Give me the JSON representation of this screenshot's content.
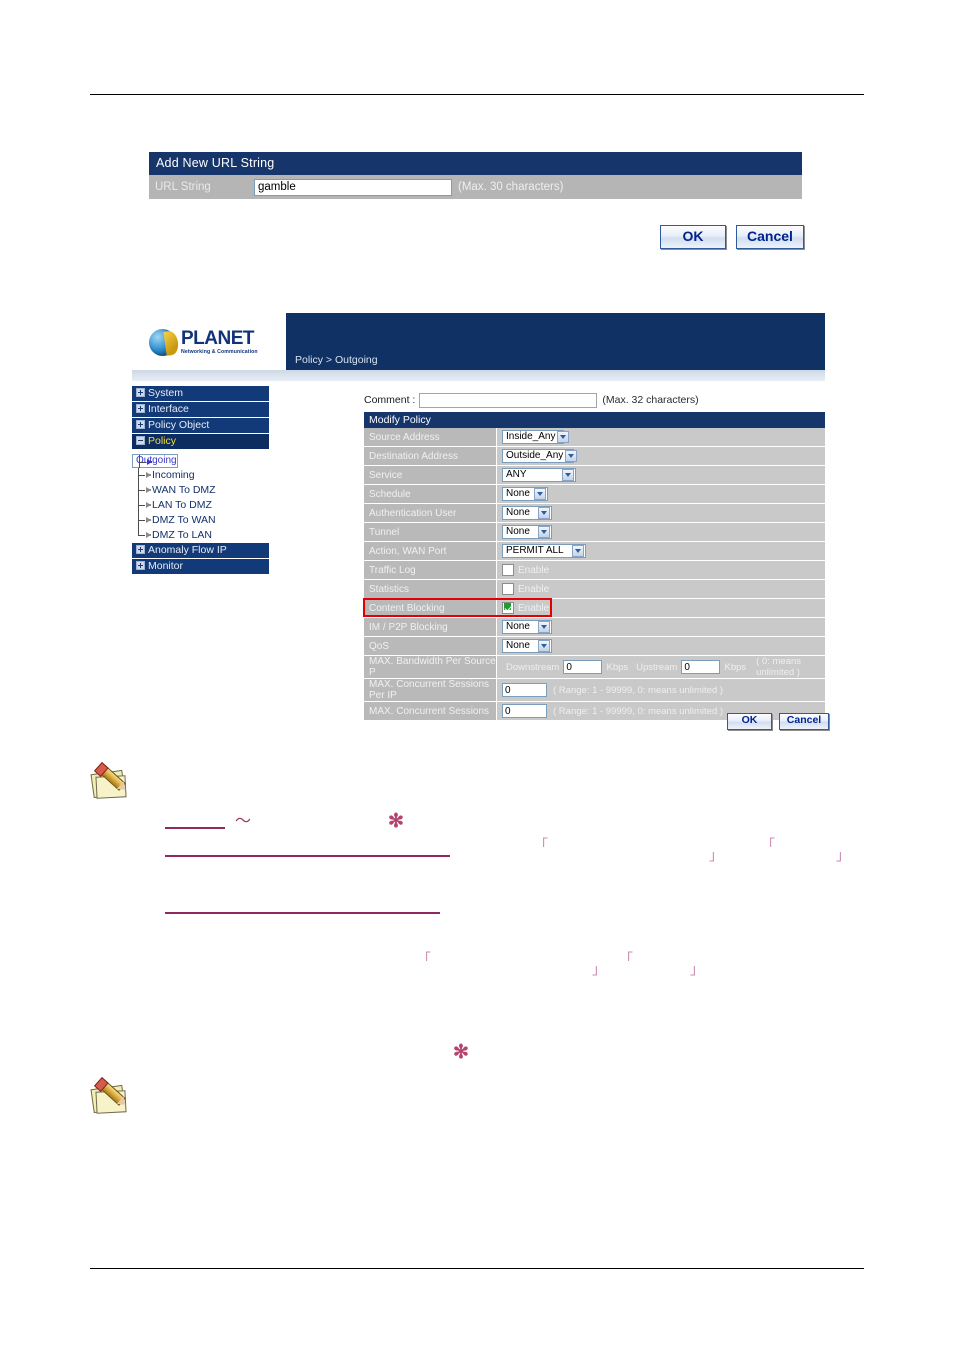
{
  "panel_url": {
    "title": "Add New URL String",
    "field_label": "URL String",
    "field_value": "gamble",
    "field_hint": "(Max. 30 characters)",
    "ok_label": "OK",
    "cancel_label": "Cancel"
  },
  "device": {
    "logo_word": "PLANET",
    "logo_tagline": "Networking & Communication",
    "breadcrumb": "Policy > Outgoing",
    "sidebar": [
      {
        "label": "System",
        "type": "top",
        "state": "collapsed"
      },
      {
        "label": "Interface",
        "type": "top",
        "state": "collapsed"
      },
      {
        "label": "Policy Object",
        "type": "top",
        "state": "collapsed"
      },
      {
        "label": "Policy",
        "type": "top",
        "state": "expanded"
      },
      {
        "label": "Outgoing",
        "type": "sub",
        "state": "selected"
      },
      {
        "label": "Incoming",
        "type": "sub",
        "state": "normal"
      },
      {
        "label": "WAN To DMZ",
        "type": "sub",
        "state": "normal"
      },
      {
        "label": "LAN To DMZ",
        "type": "sub",
        "state": "normal"
      },
      {
        "label": "DMZ To WAN",
        "type": "sub",
        "state": "normal"
      },
      {
        "label": "DMZ To LAN",
        "type": "sub",
        "state": "normal"
      },
      {
        "label": "Anomaly Flow IP",
        "type": "top",
        "state": "collapsed"
      },
      {
        "label": "Monitor",
        "type": "top",
        "state": "collapsed"
      }
    ],
    "form": {
      "comment_label": "Comment :",
      "comment_value": "",
      "comment_hint": "(Max. 32 characters)",
      "table_title": "Modify Policy",
      "rows": [
        {
          "label": "Source Address",
          "control": "select",
          "value": "Inside_Any"
        },
        {
          "label": "Destination Address",
          "control": "select",
          "value": "Outside_Any"
        },
        {
          "label": "Service",
          "control": "select",
          "value": "ANY"
        },
        {
          "label": "Schedule",
          "control": "select",
          "value": "None"
        },
        {
          "label": "Authentication User",
          "control": "select",
          "value": "None"
        },
        {
          "label": "Tunnel",
          "control": "select",
          "value": "None"
        },
        {
          "label": "Action, WAN Port",
          "control": "select",
          "value": "PERMIT ALL"
        },
        {
          "label": "Traffic Log",
          "control": "checkbox",
          "value": "Enable",
          "checked": false
        },
        {
          "label": "Statistics",
          "control": "checkbox",
          "value": "Enable",
          "checked": false
        },
        {
          "label": "Content Blocking",
          "control": "checkbox",
          "value": "Enable",
          "checked": true,
          "highlighted": true
        },
        {
          "label": "IM / P2P Blocking",
          "control": "select",
          "value": "None"
        },
        {
          "label": "QoS",
          "control": "select",
          "value": "None"
        },
        {
          "label": "MAX. Bandwidth Per Source P",
          "control": "bandwidth"
        },
        {
          "label": "MAX. Concurrent Sessions Per IP",
          "control": "range",
          "value": "0",
          "hint": "( Range: 1 - 99999, 0: means unlimited )"
        },
        {
          "label": "MAX. Concurrent Sessions",
          "control": "range",
          "value": "0",
          "hint": "( Range: 1 - 99999, 0: means unlimited )"
        }
      ],
      "bandwidth": {
        "down_label": "Downstream",
        "down_value": "0",
        "down_unit": "Kbps",
        "up_label": "Upstream",
        "up_value": "0",
        "up_unit": "Kbps",
        "hint": "( 0: means unlimited )"
      },
      "ok_label": "OK",
      "cancel_label": "Cancel"
    }
  },
  "annotations": {
    "tilde": "～",
    "asterisk1": "✻",
    "asterisk2": "✻",
    "bracket_open": "「",
    "bracket_close": "」"
  },
  "colors": {
    "header_blue": "#16356b",
    "nav_blue": "#123a78",
    "selected_yellow": "#f2df3c",
    "highlight_red": "#e40000",
    "check_green": "#1f9c2e",
    "rule_purple": "#8e2a5e",
    "bracket_pink": "#c98ab0"
  }
}
